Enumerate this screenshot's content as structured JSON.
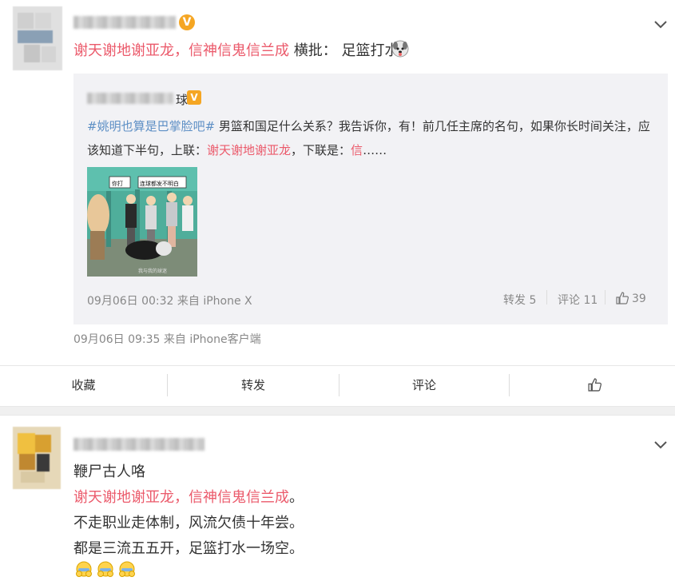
{
  "post1": {
    "verified_badge": "V",
    "content": {
      "part1": "谢天谢地谢亚龙，信神信鬼信兰成",
      "part2": " 横批： 足篮打水"
    },
    "quoted": {
      "author_suffix": "球",
      "verified_badge": "V",
      "hashtag": "#姚明也算是巴掌脸吧#",
      "line1_rest": " 男篮和国足什么关系？我告诉你，有！前几任主席的名句，如果你长时间关注，应",
      "line2_a": "该知道下半句，上联：",
      "line2_red1": "谢天谢地谢亚龙",
      "line2_b": "，下联是：",
      "line2_red2": "信",
      "line2_c": "……",
      "image_caption_left": "你打",
      "image_caption_right": "连球都发不明白",
      "image_watermark": "我与我的球迷",
      "time": "09月06日 00:32 来自 iPhone X",
      "repost": "转发 5",
      "comment": "评论 11",
      "likes": "39"
    },
    "time": "09月06日 09:35  来自 iPhone客户端",
    "actions": {
      "collect": "收藏",
      "repost": "转发",
      "comment": "评论"
    }
  },
  "post2": {
    "line1": "鞭尸古人咯",
    "line2": "谢天谢地谢亚龙，信神信鬼信兰成",
    "line2_end": "。",
    "line3": "不走职业走体制，风流欠债十年尝。",
    "line4_a": "都是三流五五开",
    "line4_b": "，足篮打水一场空。"
  },
  "colors": {
    "link_red": "#eb5a6b",
    "topic_blue": "#5d8fc5",
    "verified_orange": "#f5a623"
  },
  "icons": [
    "chevron-down-icon",
    "emoji-dog-icon",
    "thumb-up-icon",
    "emoji-cover-face-icon"
  ]
}
